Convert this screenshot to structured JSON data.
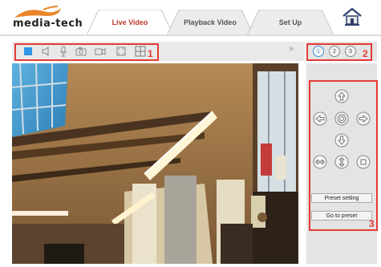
{
  "brand": {
    "logo_text": "media-tech"
  },
  "tabs": [
    {
      "label": "Live Video",
      "active": true
    },
    {
      "label": "Playback Video",
      "active": false
    },
    {
      "label": "Set Up",
      "active": false
    }
  ],
  "toolbar": {
    "icons": [
      "stop-square-icon",
      "speaker-icon",
      "microphone-icon",
      "snapshot-camera-icon",
      "record-video-icon",
      "fullscreen-icon",
      "grid-layout-icon"
    ],
    "expand_glyph": "»"
  },
  "stream_tabs": [
    "1",
    "2",
    "3"
  ],
  "ptz": {
    "preset_setting": "Preset setting",
    "go_to_preset": "Go to preset"
  },
  "callouts": [
    "1",
    "2",
    "3"
  ],
  "colors": {
    "accent_red": "#e53935",
    "active_tab_text": "#c0392b",
    "panel_bg": "#e4e4e4"
  }
}
